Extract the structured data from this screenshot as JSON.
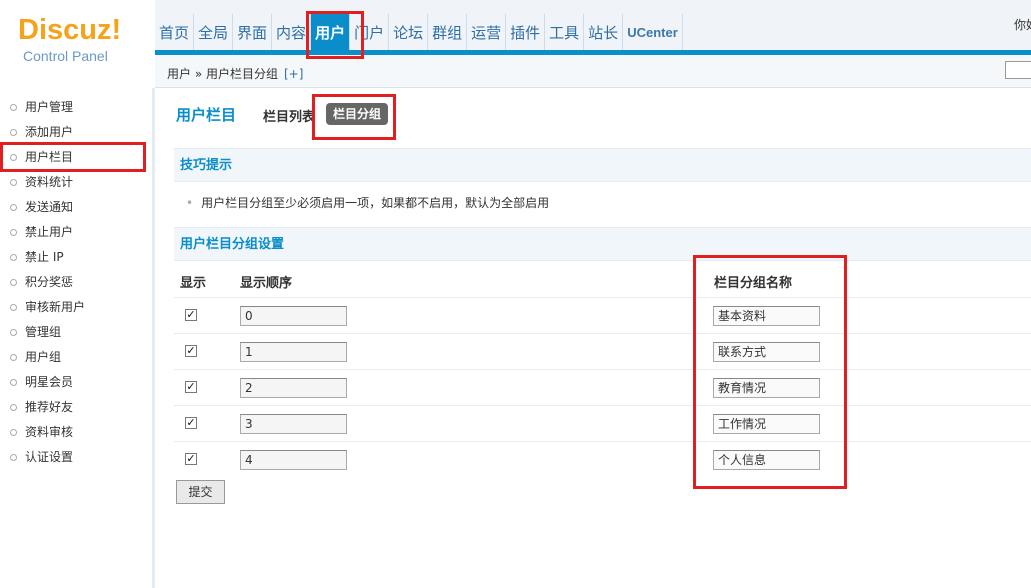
{
  "header": {
    "logo_brand": "Discuz!",
    "logo_sub": "Control Panel",
    "user_greet": "你好",
    "nav": [
      {
        "label": "首页"
      },
      {
        "label": "全局"
      },
      {
        "label": "界面"
      },
      {
        "label": "内容"
      },
      {
        "label": "用户",
        "active": true
      },
      {
        "label": "门户"
      },
      {
        "label": "论坛"
      },
      {
        "label": "群组"
      },
      {
        "label": "运营"
      },
      {
        "label": "插件"
      },
      {
        "label": "工具"
      },
      {
        "label": "站长"
      },
      {
        "label": "UCenter"
      }
    ]
  },
  "breadcrumb": {
    "text": "用户 » 用户栏目分组",
    "plus": "[+]"
  },
  "sidebar": {
    "items": [
      {
        "label": "用户管理"
      },
      {
        "label": "添加用户"
      },
      {
        "label": "用户栏目",
        "selected": true
      },
      {
        "label": "资料统计"
      },
      {
        "label": "发送通知"
      },
      {
        "label": "禁止用户"
      },
      {
        "label": "禁止 IP"
      },
      {
        "label": "积分奖惩"
      },
      {
        "label": "审核新用户"
      },
      {
        "label": "管理组"
      },
      {
        "label": "用户组"
      },
      {
        "label": "明星会员"
      },
      {
        "label": "推荐好友"
      },
      {
        "label": "资料审核"
      },
      {
        "label": "认证设置"
      }
    ]
  },
  "main": {
    "title": "用户栏目",
    "tabs": {
      "list": "栏目列表",
      "group": "栏目分组"
    },
    "tips": {
      "heading": "技巧提示",
      "line": "用户栏目分组至少必须启用一项，如果都不启用，默认为全部启用"
    },
    "settings": {
      "heading": "用户栏目分组设置",
      "col_show": "显示",
      "col_order": "显示顺序",
      "col_name": "栏目分组名称",
      "rows": [
        {
          "checked": true,
          "order": "0",
          "name": "基本资料"
        },
        {
          "checked": true,
          "order": "1",
          "name": "联系方式"
        },
        {
          "checked": true,
          "order": "2",
          "name": "教育情况"
        },
        {
          "checked": true,
          "order": "3",
          "name": "工作情况"
        },
        {
          "checked": true,
          "order": "4",
          "name": "个人信息"
        }
      ]
    },
    "submit_label": "提交"
  },
  "colors": {
    "accent": "#0a8dcb",
    "logo": "#f7a21b",
    "highlight": "#e02020"
  }
}
